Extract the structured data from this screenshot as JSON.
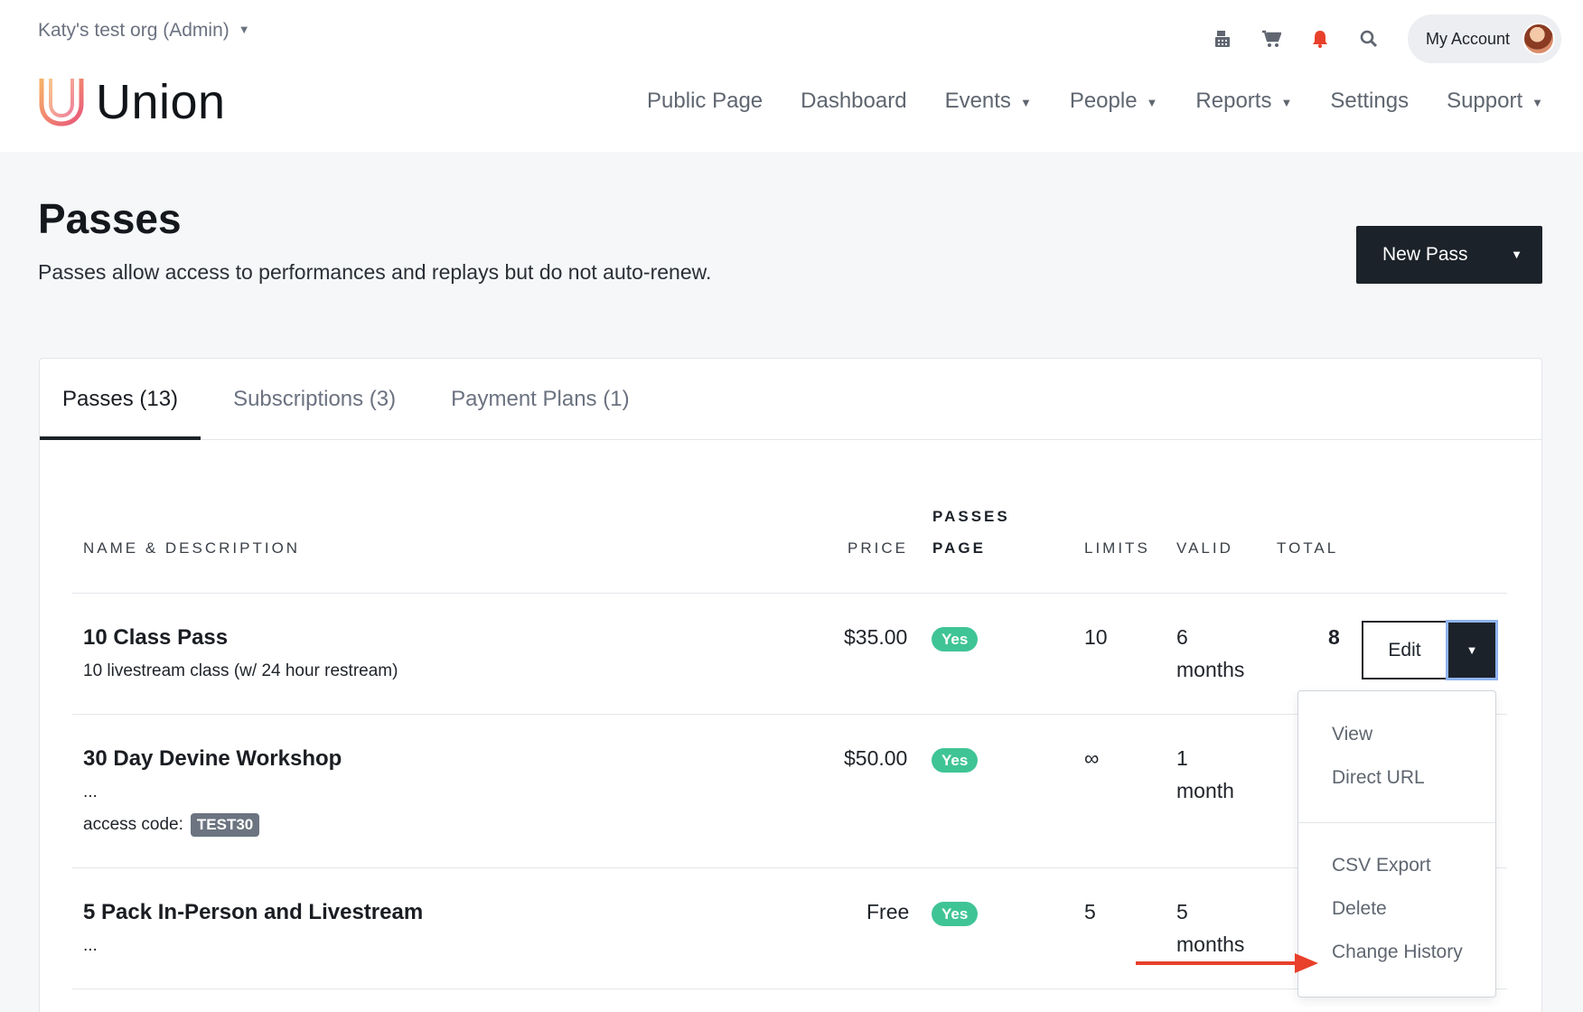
{
  "header": {
    "org": "Katy's test org (Admin)",
    "account": "My Account",
    "brand": "Union",
    "nav": [
      {
        "label": "Public Page",
        "dropdown": false
      },
      {
        "label": "Dashboard",
        "dropdown": false
      },
      {
        "label": "Events",
        "dropdown": true
      },
      {
        "label": "People",
        "dropdown": true
      },
      {
        "label": "Reports",
        "dropdown": true
      },
      {
        "label": "Settings",
        "dropdown": false
      },
      {
        "label": "Support",
        "dropdown": true
      }
    ]
  },
  "page": {
    "title": "Passes",
    "subtitle": "Passes allow access to performances and replays but do not auto-renew.",
    "new_button": "New Pass"
  },
  "tabs": [
    "Passes (13)",
    "Subscriptions (3)",
    "Payment Plans (1)"
  ],
  "table": {
    "headers": {
      "name": "NAME & DESCRIPTION",
      "price": "PRICE",
      "passes_page_1": "PASSES",
      "passes_page_2": "PAGE",
      "limits": "LIMITS",
      "valid": "VALID",
      "total": "TOTAL"
    },
    "rows": [
      {
        "name": "10 Class Pass",
        "desc": "10 livestream class (w/ 24 hour restream)",
        "price": "$35.00",
        "passes_page": "Yes",
        "limits": "10",
        "valid_1": "6",
        "valid_2": "months",
        "total": "8"
      },
      {
        "name": "30 Day Devine Workshop",
        "desc": "...",
        "access_label": "access code:",
        "access_code": "TEST30",
        "price": "$50.00",
        "passes_page": "Yes",
        "limits": "∞",
        "valid_1": "1",
        "valid_2": "month"
      },
      {
        "name": "5 Pack In-Person and Livestream",
        "desc": "...",
        "price": "Free",
        "passes_page": "Yes",
        "limits": "5",
        "valid_1": "5",
        "valid_2": "months"
      }
    ],
    "edit_label": "Edit"
  },
  "menu": [
    "View",
    "Direct URL",
    "CSV Export",
    "Delete",
    "Change History"
  ],
  "colors": {
    "accent_dark": "#1c2229",
    "badge_green": "#3fc496",
    "arrow_red": "#e8402a"
  }
}
